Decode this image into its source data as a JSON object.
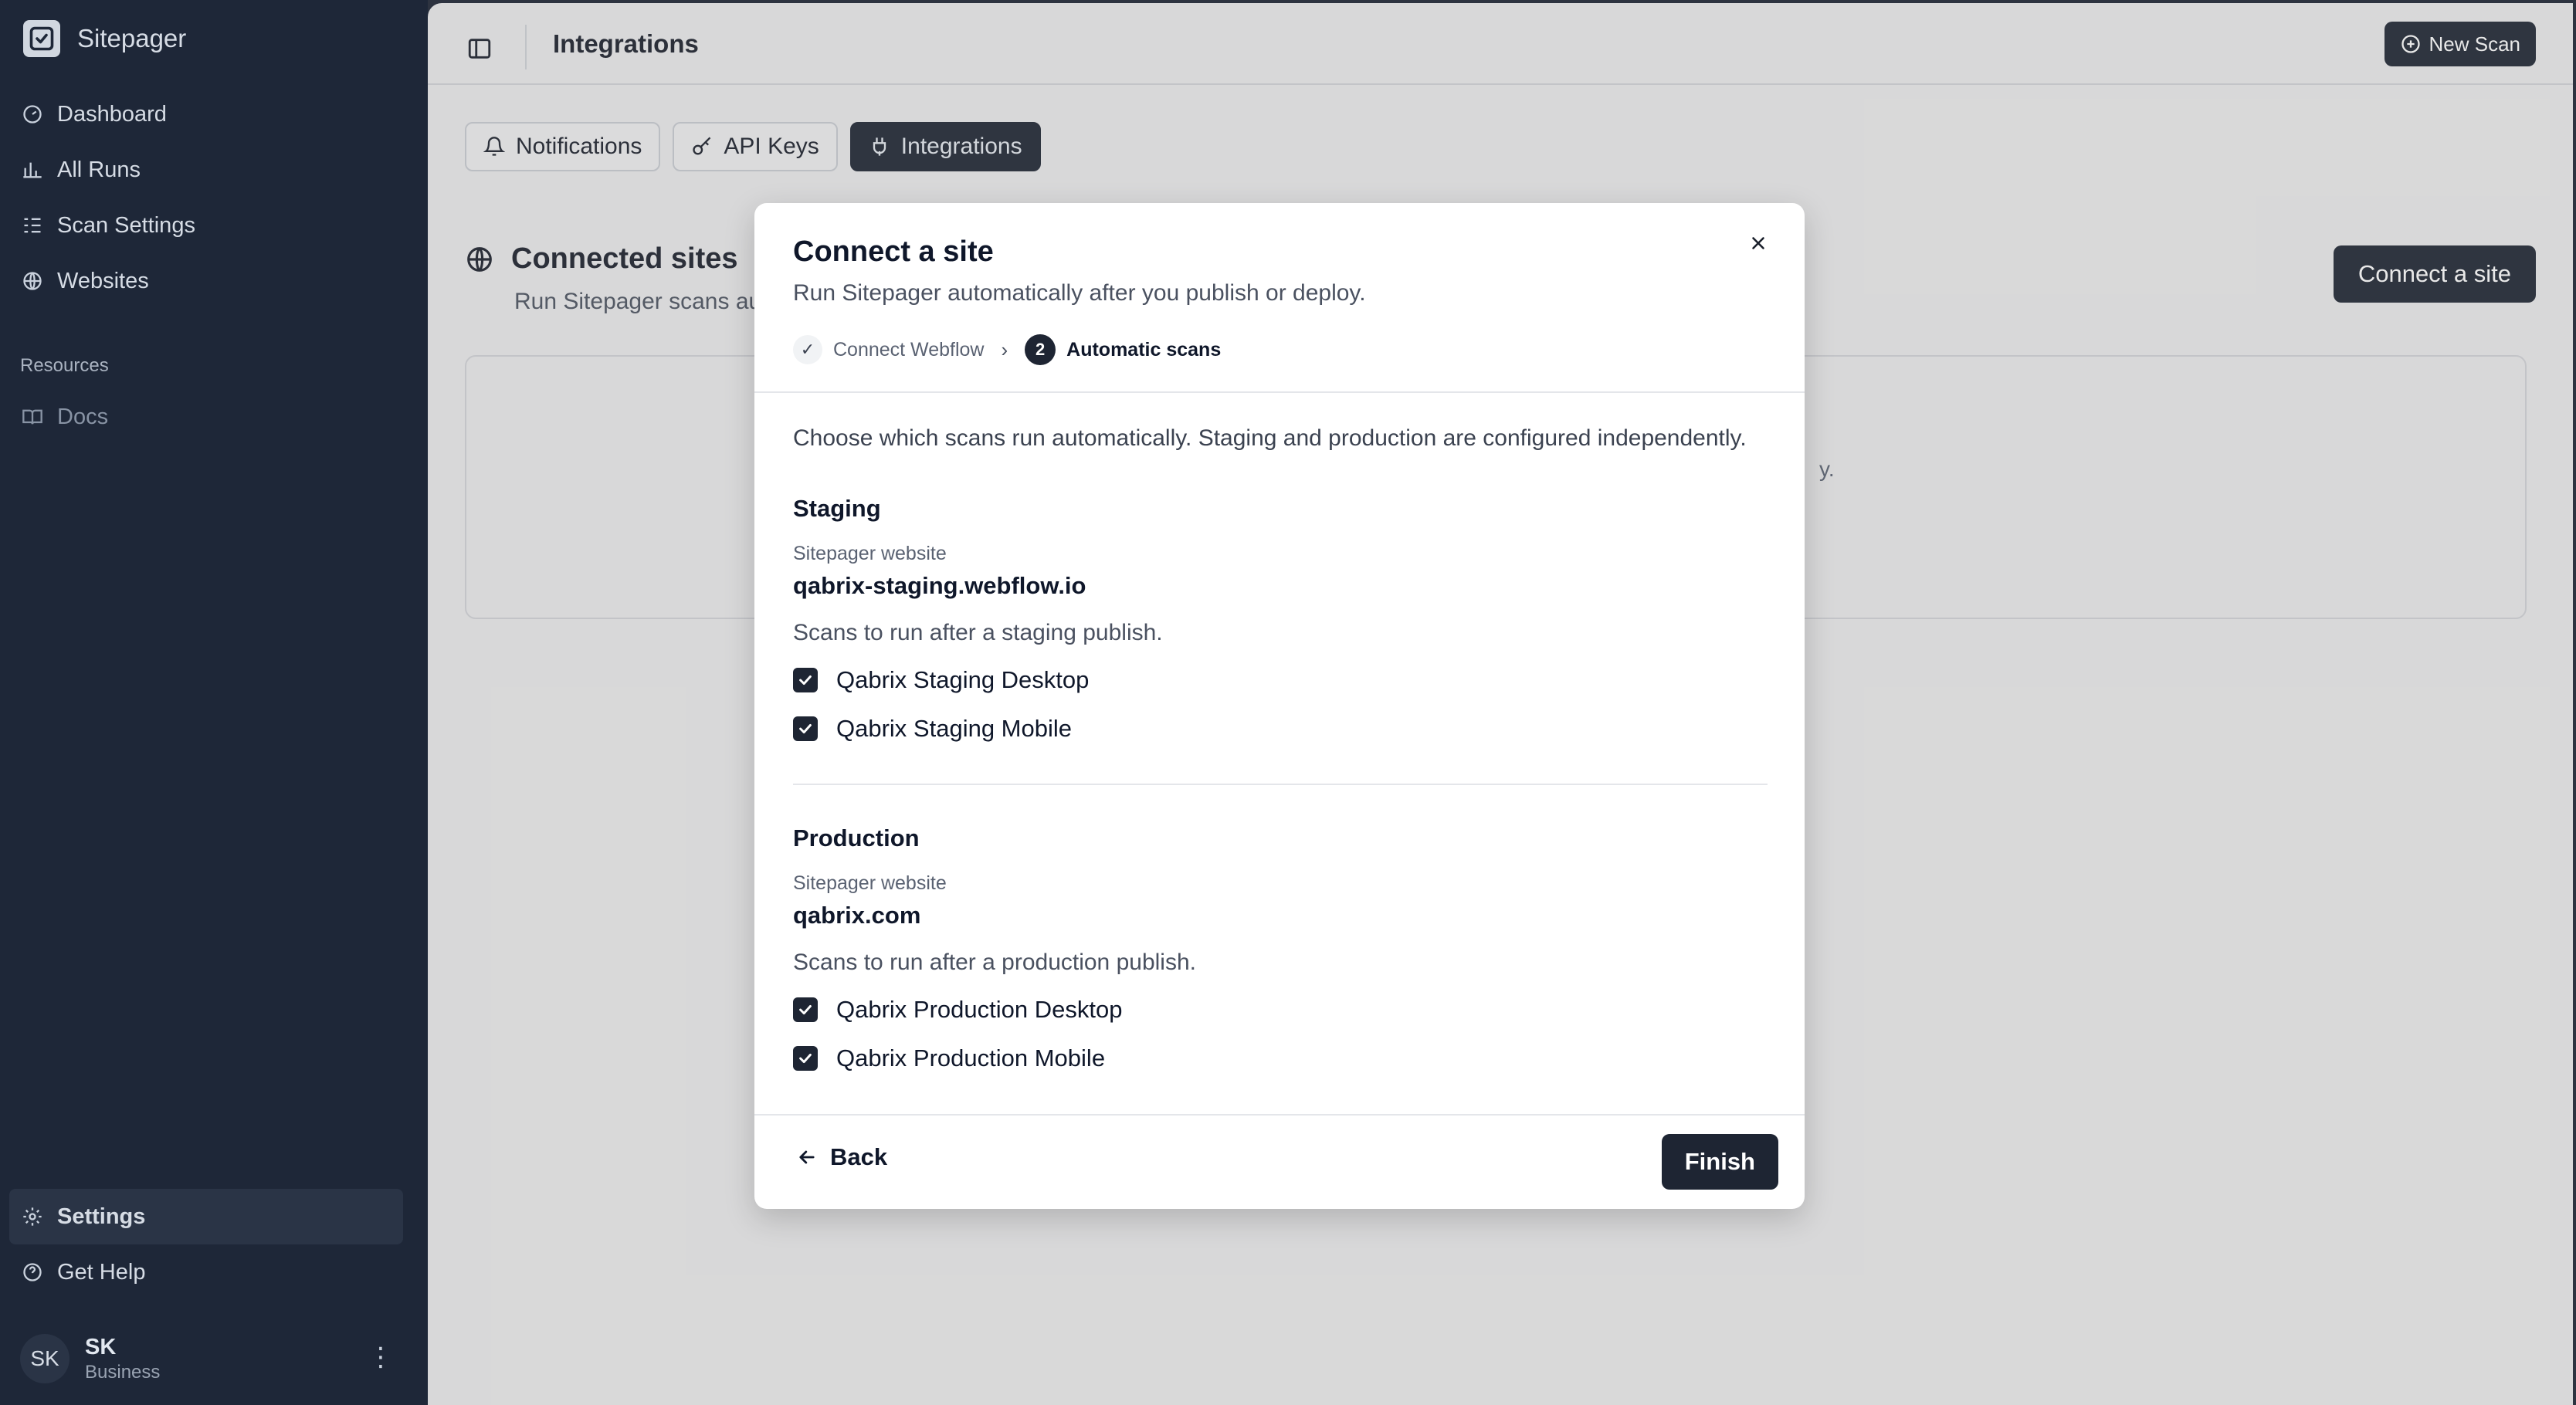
{
  "app": {
    "name": "Sitepager"
  },
  "sidebar": {
    "items": [
      {
        "label": "Dashboard",
        "icon": "gauge-icon"
      },
      {
        "label": "All Runs",
        "icon": "bar-chart-icon"
      },
      {
        "label": "Scan Settings",
        "icon": "list-settings-icon"
      },
      {
        "label": "Websites",
        "icon": "globe-icon"
      }
    ],
    "resources_label": "Resources",
    "resources": [
      {
        "label": "Docs",
        "icon": "book-icon"
      }
    ],
    "bottom": [
      {
        "label": "Settings",
        "icon": "gear-icon"
      },
      {
        "label": "Get Help",
        "icon": "help-circle-icon"
      }
    ],
    "user": {
      "initials": "SK",
      "name": "SK",
      "plan": "Business"
    }
  },
  "header": {
    "title": "Integrations",
    "new_scan_label": "New Scan"
  },
  "tabs": [
    {
      "label": "Notifications",
      "icon": "bell-icon"
    },
    {
      "label": "API Keys",
      "icon": "key-icon"
    },
    {
      "label": "Integrations",
      "icon": "plug-icon"
    }
  ],
  "section": {
    "title": "Connected sites",
    "subtitle": "Run Sitepager scans au",
    "connect_label": "Connect a site",
    "hidden_tail": "y."
  },
  "modal": {
    "title": "Connect a site",
    "subtitle": "Run Sitepager automatically after you publish or deploy.",
    "steps": [
      {
        "label": "Connect Webflow",
        "state": "done",
        "marker": "✓"
      },
      {
        "label": "Automatic scans",
        "state": "current",
        "marker": "2"
      }
    ],
    "intro": "Choose which scans run automatically. Staging and production are configured independently.",
    "staging": {
      "title": "Staging",
      "website_label": "Sitepager website",
      "website": "qabrix-staging.webflow.io",
      "hint": "Scans to run after a staging publish.",
      "scans": [
        {
          "label": "Qabrix Staging Desktop",
          "checked": true
        },
        {
          "label": "Qabrix Staging Mobile",
          "checked": true
        }
      ]
    },
    "production": {
      "title": "Production",
      "website_label": "Sitepager website",
      "website": "qabrix.com",
      "hint": "Scans to run after a production publish.",
      "scans": [
        {
          "label": "Qabrix Production Desktop",
          "checked": true
        },
        {
          "label": "Qabrix Production Mobile",
          "checked": true
        }
      ]
    },
    "back_label": "Back",
    "finish_label": "Finish"
  }
}
